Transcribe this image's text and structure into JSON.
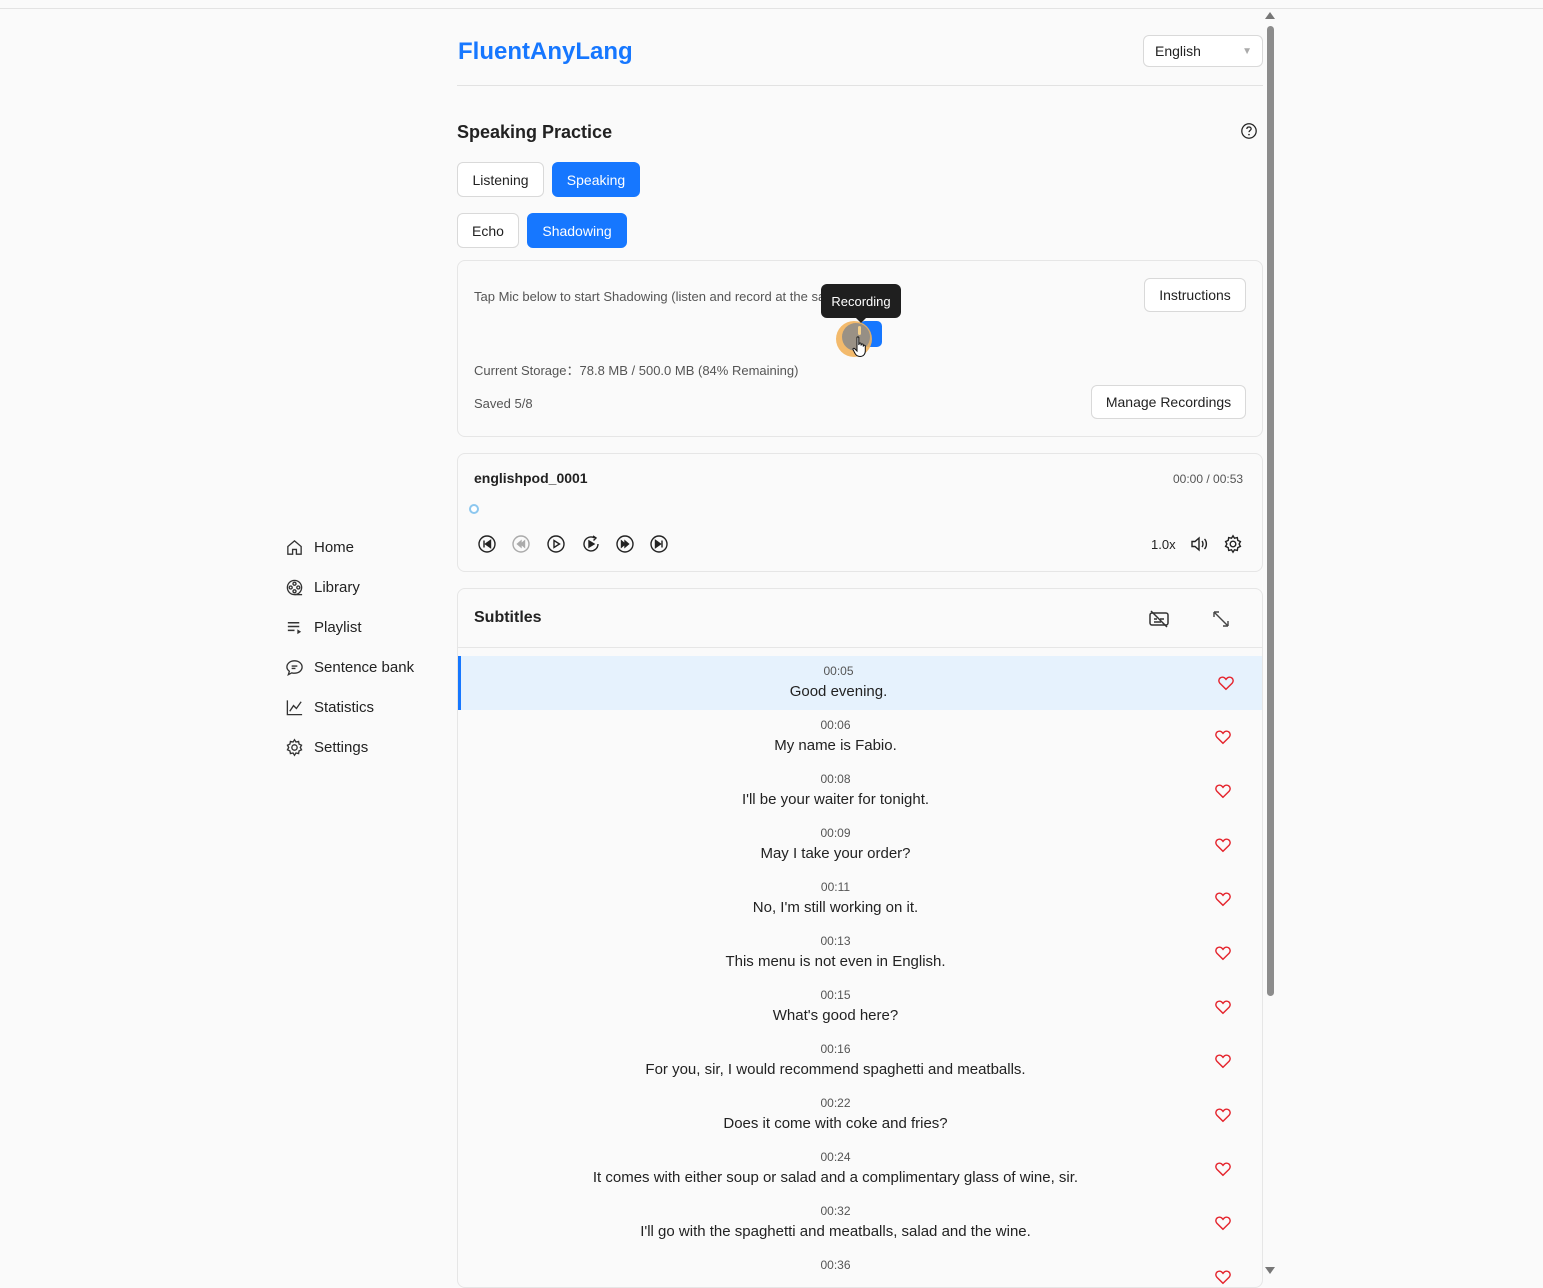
{
  "app": {
    "brand": "FluentAnyLang"
  },
  "language_select": {
    "value": "English"
  },
  "sidebar": {
    "items": [
      {
        "label": "Home",
        "icon": "home-icon"
      },
      {
        "label": "Library",
        "icon": "film-reel-icon"
      },
      {
        "label": "Playlist",
        "icon": "playlist-icon"
      },
      {
        "label": "Sentence bank",
        "icon": "chat-bubble-icon"
      },
      {
        "label": "Statistics",
        "icon": "line-chart-icon"
      },
      {
        "label": "Settings",
        "icon": "gear-icon"
      }
    ]
  },
  "practice": {
    "title": "Speaking Practice",
    "mode_tabs": [
      {
        "label": "Listening",
        "active": false
      },
      {
        "label": "Speaking",
        "active": true
      }
    ],
    "sub_tabs": [
      {
        "label": "Echo",
        "active": false
      },
      {
        "label": "Shadowing",
        "active": true
      }
    ]
  },
  "recording": {
    "instruction": "Tap Mic below to start Shadowing (listen and record at the same time).",
    "instructions_button": "Instructions",
    "tooltip": "Recording",
    "storage": "Current Storage：78.8 MB / 500.0 MB (84% Remaining)",
    "saved": "Saved 5/8",
    "manage_button": "Manage Recordings"
  },
  "player": {
    "title": "englishpod_0001",
    "time": "00:00  /  00:53",
    "speed": "1.0x",
    "progress": 0
  },
  "subtitles": {
    "title": "Subtitles",
    "rows": [
      {
        "time": "00:05",
        "text": "Good evening."
      },
      {
        "time": "00:06",
        "text": "My name is Fabio."
      },
      {
        "time": "00:08",
        "text": "I'll be your waiter for tonight."
      },
      {
        "time": "00:09",
        "text": "May I take your order?"
      },
      {
        "time": "00:11",
        "text": "No, I'm still working on it."
      },
      {
        "time": "00:13",
        "text": "This menu is not even in English."
      },
      {
        "time": "00:15",
        "text": "What's good here?"
      },
      {
        "time": "00:16",
        "text": "For you, sir, I would recommend spaghetti and meatballs."
      },
      {
        "time": "00:22",
        "text": "Does it come with coke and fries?"
      },
      {
        "time": "00:24",
        "text": "It comes with either soup or salad and a complimentary glass of wine, sir."
      },
      {
        "time": "00:32",
        "text": "I'll go with the spaghetti and meatballs, salad and the wine."
      },
      {
        "time": "00:36",
        "text": ""
      }
    ]
  },
  "colors": {
    "accent": "#1677ff",
    "active_row": "#e6f2fd",
    "heart": "#e5262f"
  }
}
